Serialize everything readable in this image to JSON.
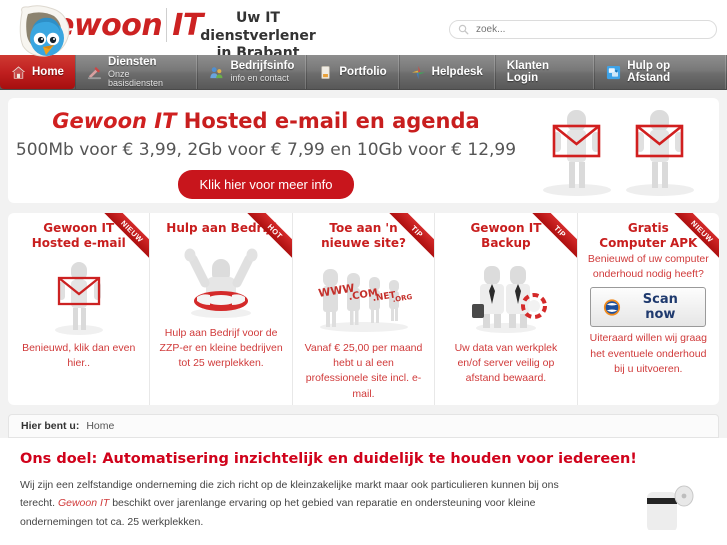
{
  "header": {
    "logo_text": "Gewoon IT",
    "logo_icon": "bird-logo-icon",
    "tagline_line1": "Uw IT dienstverlener",
    "tagline_line2": "in Brabant",
    "search": {
      "placeholder": "zoek...",
      "value": "",
      "icon": "search-icon"
    }
  },
  "nav": {
    "items": [
      {
        "title": "Home",
        "sub": "",
        "icon": "home-icon",
        "active": true
      },
      {
        "title": "Diensten",
        "sub": "Onze basisdiensten",
        "icon": "tools-icon",
        "active": false
      },
      {
        "title": "Bedrijfsinfo",
        "sub": "info en contact",
        "icon": "people-icon",
        "active": false
      },
      {
        "title": "Portfolio",
        "sub": "",
        "icon": "document-icon",
        "active": false
      },
      {
        "title": "Helpdesk",
        "sub": "",
        "icon": "lifebuoy-icon",
        "active": false
      },
      {
        "title": "Klanten Login",
        "sub": "",
        "icon": "",
        "active": false
      },
      {
        "title": "Hulp op Afstand",
        "sub": "",
        "icon": "remote-screen-icon",
        "active": false
      }
    ]
  },
  "hero": {
    "title_brand": "Gewoon IT",
    "title_rest": " Hosted e-mail en agenda",
    "subtitle": "500Mb voor € 3,99, 2Gb voor € 7,99 en 10Gb voor € 12,99",
    "cta_label": "Klik hier voor meer info",
    "art": "two-figures-holding-envelopes"
  },
  "cards": [
    {
      "ribbon": "NIEUW",
      "title": "Gewoon IT\nHosted e-mail",
      "title_l1": "Gewoon IT",
      "title_l2": "Hosted e-mail",
      "art": "figure-with-envelope",
      "desc": "Benieuwd, klik dan even hier.."
    },
    {
      "ribbon": "HOT",
      "title_l1": "Hulp aan Bedrijf",
      "title_l2": "",
      "art": "figure-in-lifering",
      "desc": "Hulp aan Bedrijf  voor de ZZP-er en kleine bedrijven tot 25 werplekken."
    },
    {
      "ribbon": "TIP",
      "title_l1": "Toe aan 'n",
      "title_l2": "nieuwe site?",
      "art": "figures-holding-domain-signs",
      "desc": "Vanaf € 25,00 per maand hebt u al een professionele site incl. e-mail."
    },
    {
      "ribbon": "TIP",
      "title_l1": "Gewoon IT",
      "title_l2": "Backup",
      "art": "two-businessmen-with-lifering",
      "desc": "Uw data van werkplek en/of server veilig op afstand bewaard."
    },
    {
      "ribbon": "NIEUW",
      "title_l1": "Gratis",
      "title_l2": "Computer APK",
      "desc_top": "Benieuwd of uw computer onderhoud nodig heeft?",
      "scan_button_label": "Scan now",
      "scan_button_icon": "scan-globe-icon",
      "desc": "Uiteraard willen wij graag het eventuele onderhoud bij u uitvoeren."
    }
  ],
  "breadcrumb": {
    "label": "Hier bent u:",
    "current": "Home"
  },
  "content": {
    "heading": "Ons doel: Automatisering inzichtelijk en duidelijk te houden voor iedereen!",
    "para_part1": "Wij zijn een zelfstandige onderneming die zich richt op de kleinzakelijke markt maar ook particulieren kunnen bij ons terecht. ",
    "para_brand": "Gewoon IT",
    "para_part2": "  beschikt over jarenlange ervaring op het gebied van reparatie en ondersteuning voor kleine ondernemingen tot ca. 25 werkplekken.",
    "art": "figure-partial"
  },
  "colors": {
    "brand_red": "#c81e1e",
    "cta_red": "#c8151c",
    "nav_gray": "#787878",
    "heading_red": "#d0021b",
    "stage_gray": "#f2f2f2"
  }
}
